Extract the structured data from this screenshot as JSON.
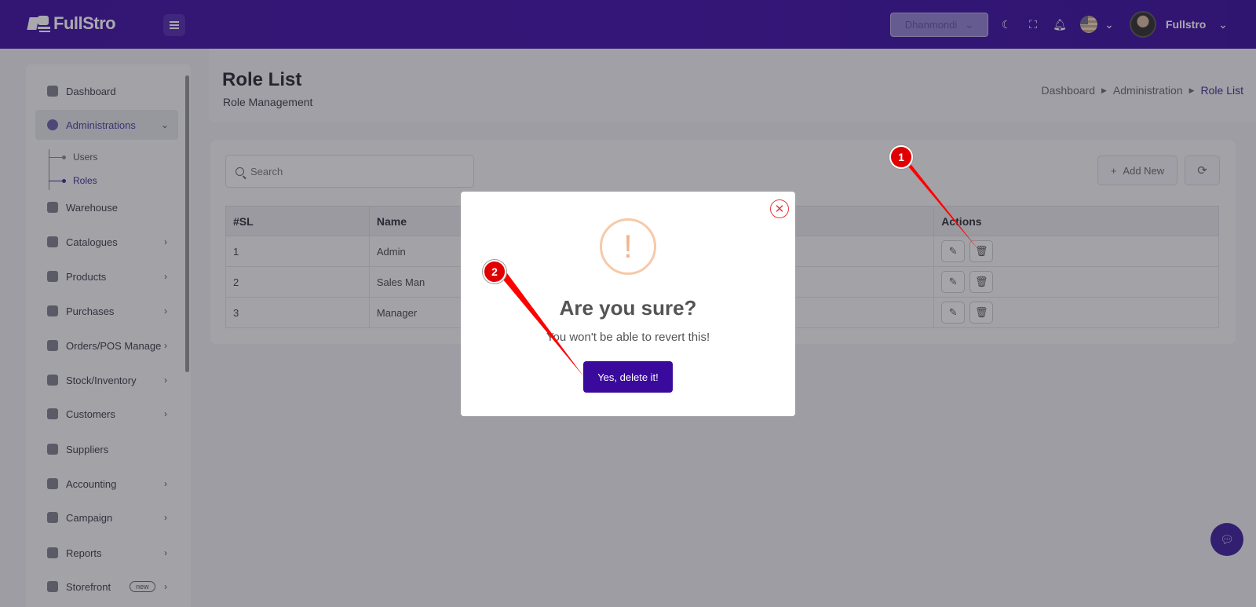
{
  "brand": {
    "name": "FullStro"
  },
  "topbar": {
    "branch": "Dhanmondi",
    "user_name": "Fullstro"
  },
  "sidebar": {
    "items": [
      {
        "label": "Dashboard"
      },
      {
        "label": "Administrations"
      },
      {
        "label": "Warehouse"
      },
      {
        "label": "Catalogues"
      },
      {
        "label": "Products"
      },
      {
        "label": "Purchases"
      },
      {
        "label": "Orders/POS Manage"
      },
      {
        "label": "Stock/Inventory"
      },
      {
        "label": "Customers"
      },
      {
        "label": "Suppliers"
      },
      {
        "label": "Accounting"
      },
      {
        "label": "Campaign"
      },
      {
        "label": "Reports"
      },
      {
        "label": "Storefront",
        "badge": "new"
      }
    ],
    "sub_items": [
      {
        "label": "Users"
      },
      {
        "label": "Roles"
      }
    ]
  },
  "page": {
    "title": "Role List",
    "subtitle": "Role Management",
    "breadcrumb": [
      "Dashboard",
      "Administration",
      "Role List"
    ]
  },
  "toolbar": {
    "search_placeholder": "Search",
    "add_label": "Add New"
  },
  "table": {
    "headers": [
      "#SL",
      "Name",
      "",
      "Actions"
    ],
    "rows": [
      {
        "sl": "1",
        "name": "Admin"
      },
      {
        "sl": "2",
        "name": "Sales Man"
      },
      {
        "sl": "3",
        "name": "Manager"
      }
    ]
  },
  "modal": {
    "icon": "!",
    "title": "Are you sure?",
    "text": "You won't be able to revert this!",
    "confirm_label": "Yes, delete it!"
  },
  "annotations": [
    "1",
    "2"
  ],
  "colors": {
    "brand": "#3a0ca3",
    "confirm": "#3a0a9c",
    "warning": "#f4b48a",
    "marker": "#e00000"
  }
}
